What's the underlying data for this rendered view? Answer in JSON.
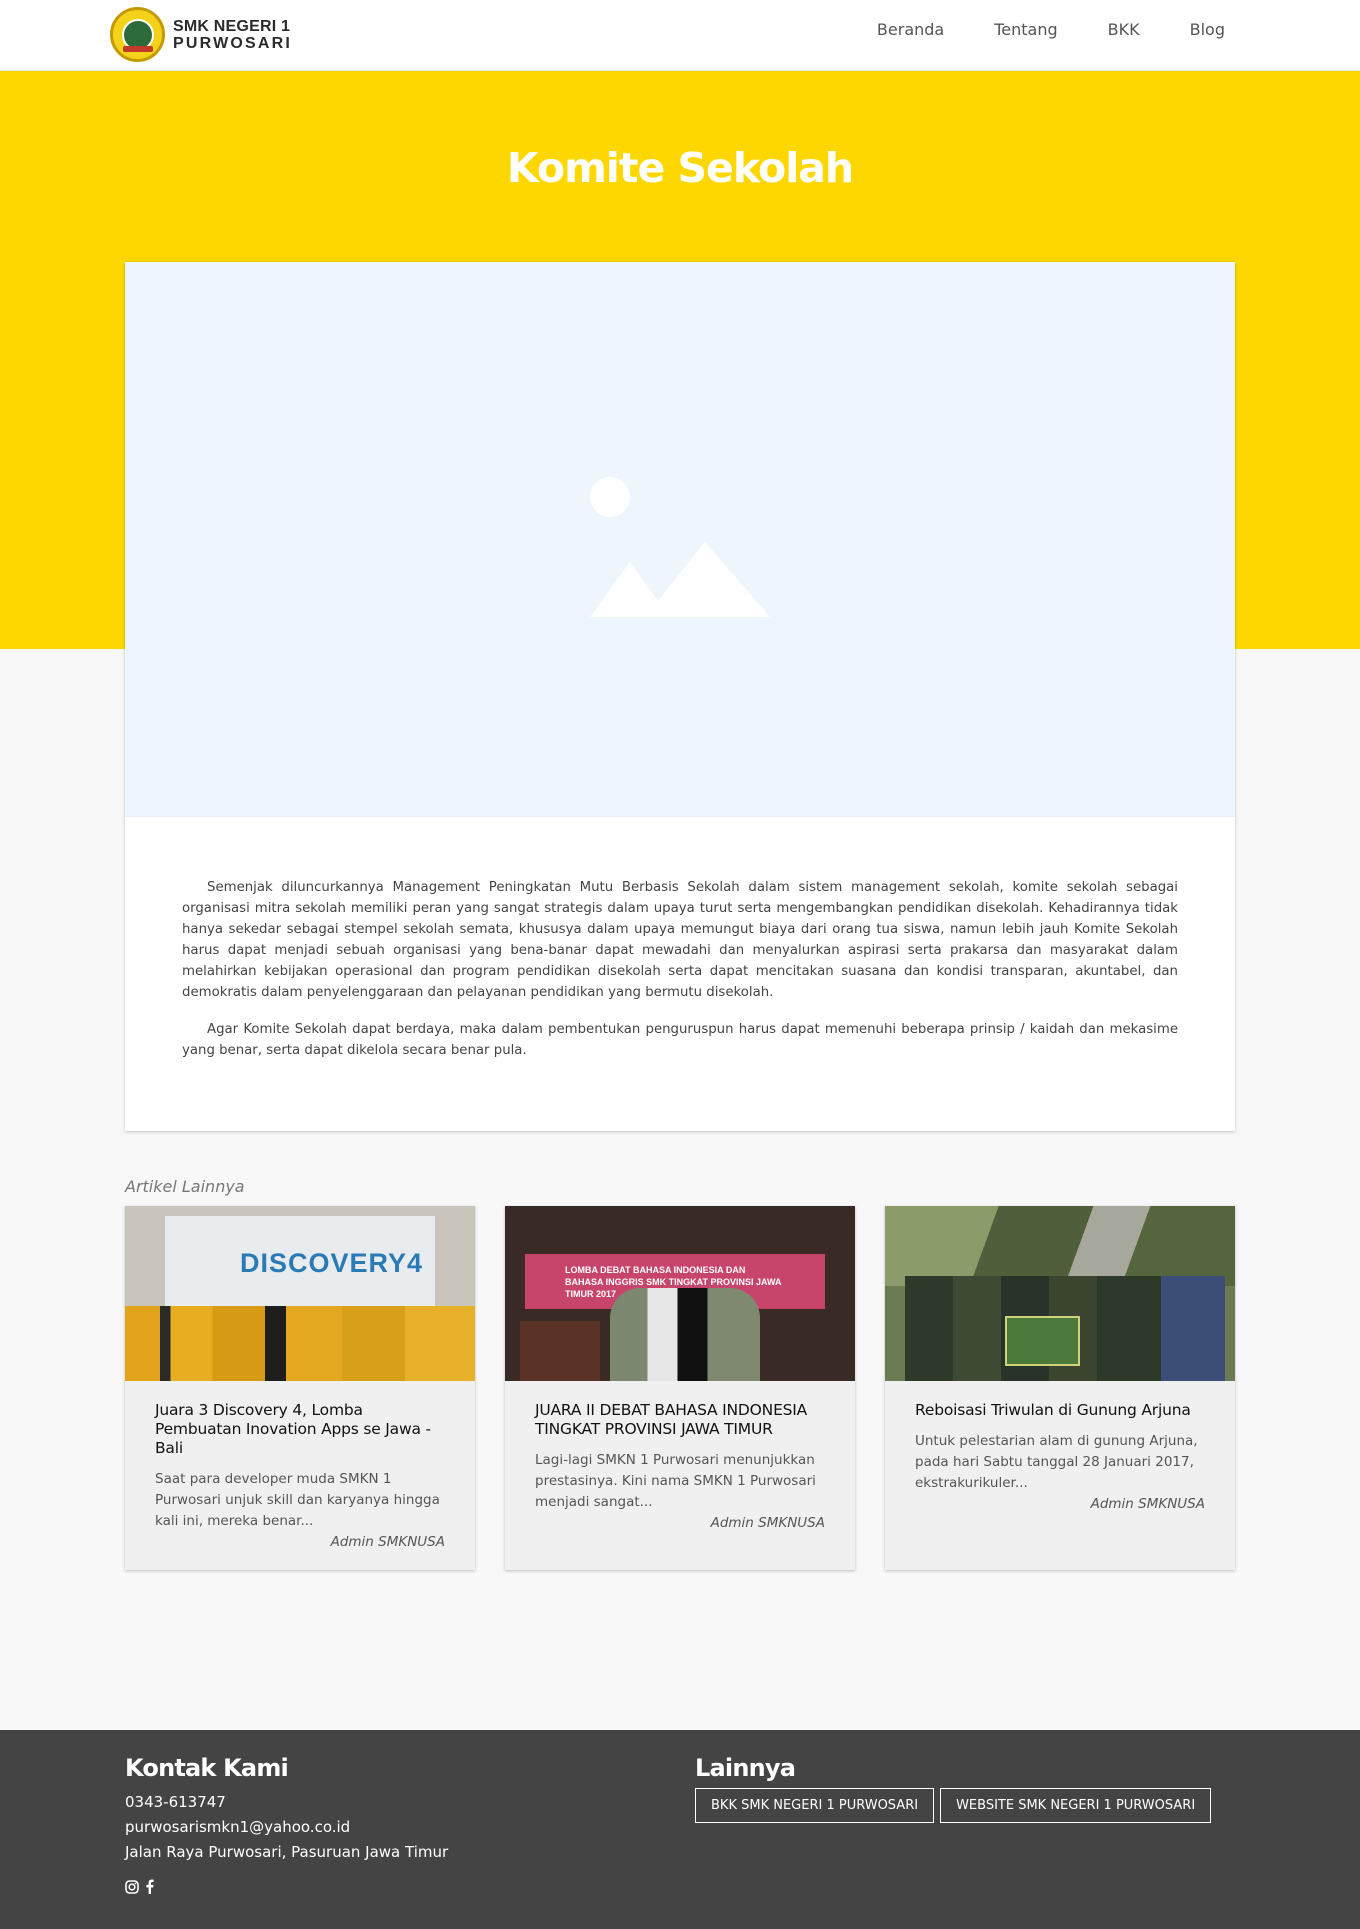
{
  "navbar": {
    "brand_line1": "SMK NEGERI 1",
    "brand_line2": "PURWOSARI",
    "links": [
      "Beranda",
      "Tentang",
      "BKK",
      "Blog"
    ]
  },
  "hero": {
    "title": "Komite Sekolah"
  },
  "article": {
    "image_icon": "image-placeholder-icon",
    "paragraphs": [
      "Semenjak diluncurkannya Management Peningkatan Mutu Berbasis Sekolah dalam sistem management sekolah, komite sekolah sebagai organisasi mitra sekolah memiliki peran yang sangat strategis dalam upaya turut serta mengembangkan pendidikan disekolah. Kehadirannya tidak hanya sekedar sebagai stempel sekolah semata, khususya dalam upaya memungut biaya dari orang tua siswa, namun lebih jauh Komite Sekolah harus dapat menjadi sebuah organisasi yang bena-banar dapat mewadahi dan menyalurkan aspirasi serta prakarsa dan masyarakat dalam melahirkan kebijakan operasional dan program pendidikan disekolah serta dapat mencitakan suasana dan kondisi transparan, akuntabel, dan demokratis dalam penyelenggaraan dan pelayanan pendidikan yang bermutu disekolah.",
      "Agar Komite Sekolah dapat berdaya, maka dalam pembentukan penguruspun harus dapat memenuhi beberapa prinsip / kaidah dan mekasime yang benar, serta dapat dikelola secara benar pula."
    ]
  },
  "others": {
    "label": "Artikel Lainnya",
    "items": [
      {
        "title": "Juara 3 Discovery 4, Lomba Pembuatan Inovation Apps se Jawa - Bali",
        "excerpt": "Saat para developer muda SMKN 1 Purwosari unjuk skill dan karyanya hingga kali ini, mereka benar...",
        "author": "Admin SMKNUSA",
        "thumb_text": "DISCOVERY4"
      },
      {
        "title": "JUARA II DEBAT BAHASA INDONESIA TINGKAT PROVINSI JAWA TIMUR",
        "excerpt": "Lagi-lagi SMKN 1 Purwosari menunjukkan prestasinya. Kini nama SMKN 1 Purwosari menjadi sangat...",
        "author": "Admin SMKNUSA",
        "thumb_text": "LOMBA DEBAT BAHASA INDONESIA DAN BAHASA INGGRIS SMK TINGKAT PROVINSI JAWA TIMUR 2017"
      },
      {
        "title": "Reboisasi Triwulan di Gunung Arjuna",
        "excerpt": "Untuk pelestarian alam di gunung Arjuna, pada hari Sabtu tanggal 28 Januari 2017, ekstrakurikuler...",
        "author": "Admin SMKNUSA"
      }
    ]
  },
  "footer": {
    "contact_title": "Kontak Kami",
    "phone": "0343-613747",
    "email": "purwosarismkn1@yahoo.co.id",
    "address": "Jalan Raya Purwosari, Pasuruan Jawa Timur",
    "social_icons": [
      "instagram-icon",
      "facebook-icon"
    ],
    "other_title": "Lainnya",
    "buttons": [
      "BKK SMK NEGERI 1 PURWOSARI",
      "WEBSITE SMK NEGERI 1 PURWOSARI"
    ]
  }
}
